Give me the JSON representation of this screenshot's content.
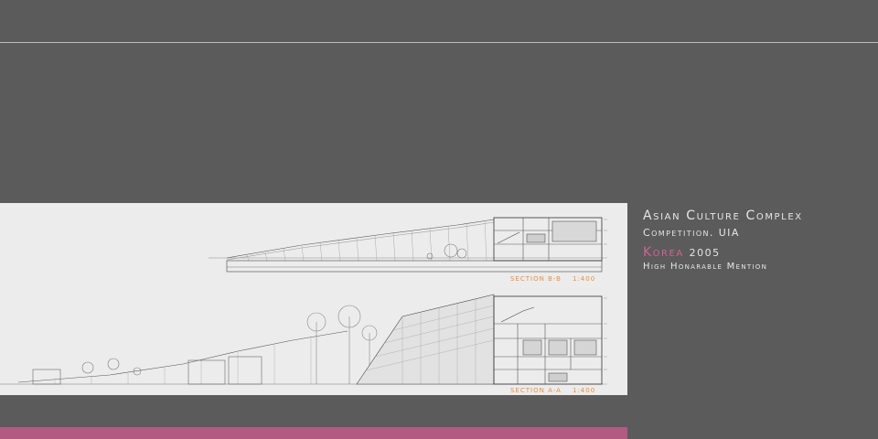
{
  "project": {
    "title": "Asian Culture Complex",
    "subtitle": "Competition. UIA",
    "country": "Korea",
    "year": "2005",
    "award": "High Honarable Mention"
  },
  "drawings": {
    "section_bb": {
      "label": "SECTION B-B",
      "scale": "1:400"
    },
    "section_aa": {
      "label": "SECTION A-A",
      "scale": "1:400"
    }
  },
  "colors": {
    "background": "#5b5b5b",
    "sheet": "#ececec",
    "accent_pink": "#b25a82",
    "label_orange": "#e98d3f",
    "rule": "#bdbdbd"
  }
}
